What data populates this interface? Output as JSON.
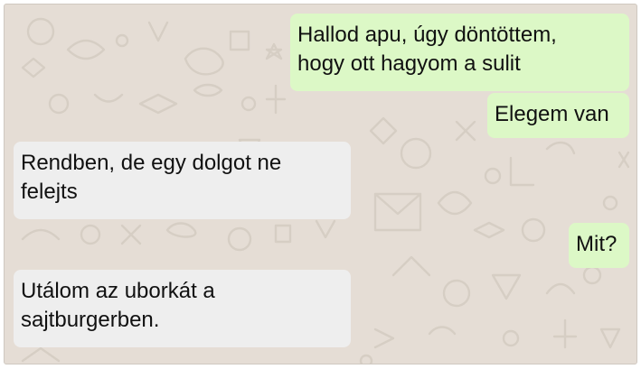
{
  "colors": {
    "chat_background": "#e5ddd5",
    "outgoing_bubble": "#dcf8c6",
    "incoming_bubble": "#eeeeee",
    "text": "#111111"
  },
  "messages": [
    {
      "direction": "outgoing",
      "lines": [
        "Hallod apu, úgy döntöttem,",
        "hogy ott hagyom a sulit"
      ]
    },
    {
      "direction": "outgoing",
      "lines": [
        "Elegem van"
      ]
    },
    {
      "direction": "incoming",
      "lines": [
        "Rendben, de egy dolgot ne",
        "felejts"
      ]
    },
    {
      "direction": "outgoing",
      "lines": [
        "Mit?"
      ]
    },
    {
      "direction": "incoming",
      "lines": [
        "Utálom az uborkát a",
        "sajtburgerben."
      ]
    }
  ]
}
